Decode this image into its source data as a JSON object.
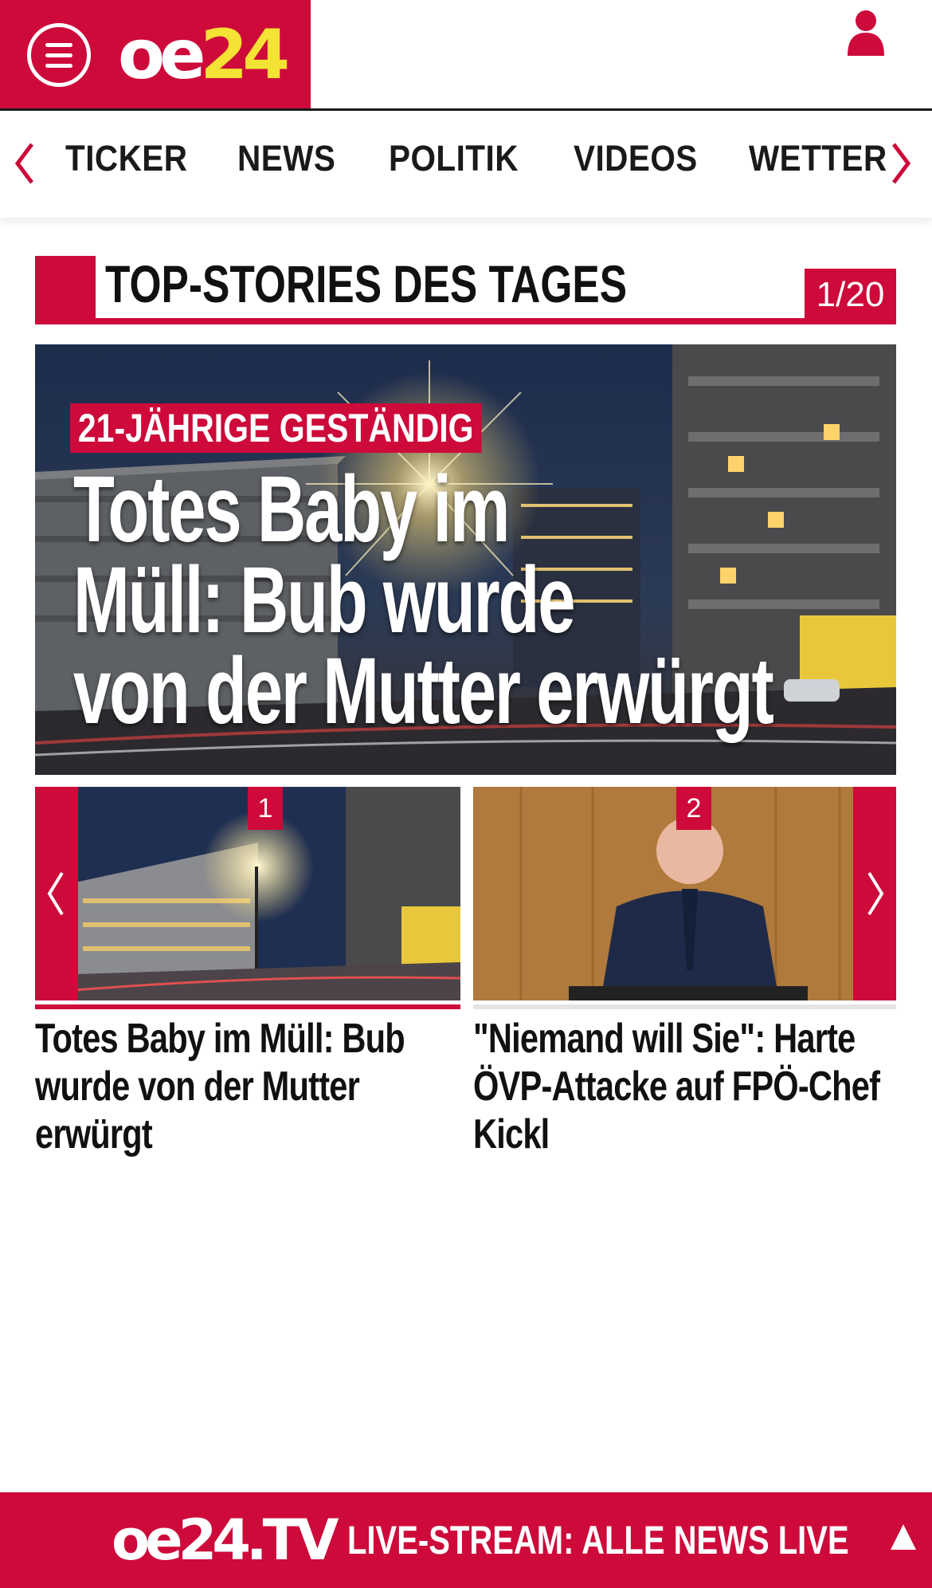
{
  "header": {
    "logo_oe": "oe",
    "logo_num": "24",
    "brand_color": "#cd0a3a",
    "logo_accent": "#f4e234",
    "menu_icon": "hamburger-menu-icon",
    "user_icon": "user-icon"
  },
  "nav": {
    "items": [
      {
        "label": "TICKER"
      },
      {
        "label": "NEWS"
      },
      {
        "label": "POLITIK"
      },
      {
        "label": "VIDEOS"
      },
      {
        "label": "WETTER"
      }
    ]
  },
  "section": {
    "title": "TOP-STORIES DES TAGES",
    "counter": "1/20"
  },
  "hero": {
    "kicker": "21-JÄHRIGE GESTÄNDIG",
    "title_lines": [
      "Totes Baby im",
      "Müll: Bub wurde",
      "von der Mutter erwürgt"
    ]
  },
  "cards": [
    {
      "num": "1",
      "title": "Totes Baby im Müll: Bub wurde von der Mutter erwürgt"
    },
    {
      "num": "2",
      "title": "\"Niemand will Sie\": Harte ÖVP-Attacke auf FPÖ-Chef Kickl"
    }
  ],
  "footer": {
    "logo": "oe24.TV",
    "label": "LIVE-STREAM:",
    "text": "ALLE NEWS LIVE"
  }
}
